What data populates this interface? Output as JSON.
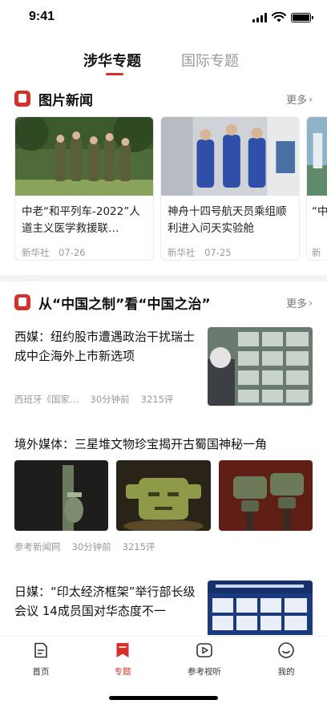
{
  "status": {
    "time": "9:41"
  },
  "top_tabs": [
    {
      "label": "涉华专题",
      "active": true
    },
    {
      "label": "国际专题",
      "active": false
    }
  ],
  "photo_news": {
    "title": "图片新闻",
    "more": "更多",
    "cards": [
      {
        "title": "中老“和平列车-2022”人道主义医学救援联…",
        "source": "新华社",
        "date": "07-26"
      },
      {
        "title": "神舟十四号航天员乘组顺利进入问天实验舱",
        "source": "新华社",
        "date": "07-25"
      },
      {
        "title": "“中发",
        "source": "新华",
        "date": ""
      }
    ]
  },
  "topic": {
    "title": "从“中国之制”看“中国之治”",
    "more": "更多",
    "articles": [
      {
        "title": "西媒：纽约股市遭遇政治干扰瑞士成中企海外上市新选项",
        "source": "西班牙《国家…",
        "time": "30分钟前",
        "comments": "3215评"
      },
      {
        "title": "境外媒体：三星堆文物珍宝揭开古蜀国神秘一角",
        "source": "参考新闻网",
        "time": "30分钟前",
        "comments": "3215评"
      },
      {
        "title": "日媒：“印太经济框架”举行部长级会议 14成员国对华态度不一"
      }
    ]
  },
  "tabbar": [
    {
      "label": "首页",
      "icon": "home-doc-icon",
      "active": false
    },
    {
      "label": "专题",
      "icon": "bookmark-icon",
      "active": true
    },
    {
      "label": "参考视听",
      "icon": "play-icon",
      "active": false
    },
    {
      "label": "我的",
      "icon": "smile-face-icon",
      "active": false
    }
  ],
  "colors": {
    "accent": "#d6302a",
    "muted": "#999999",
    "text": "#111111"
  }
}
